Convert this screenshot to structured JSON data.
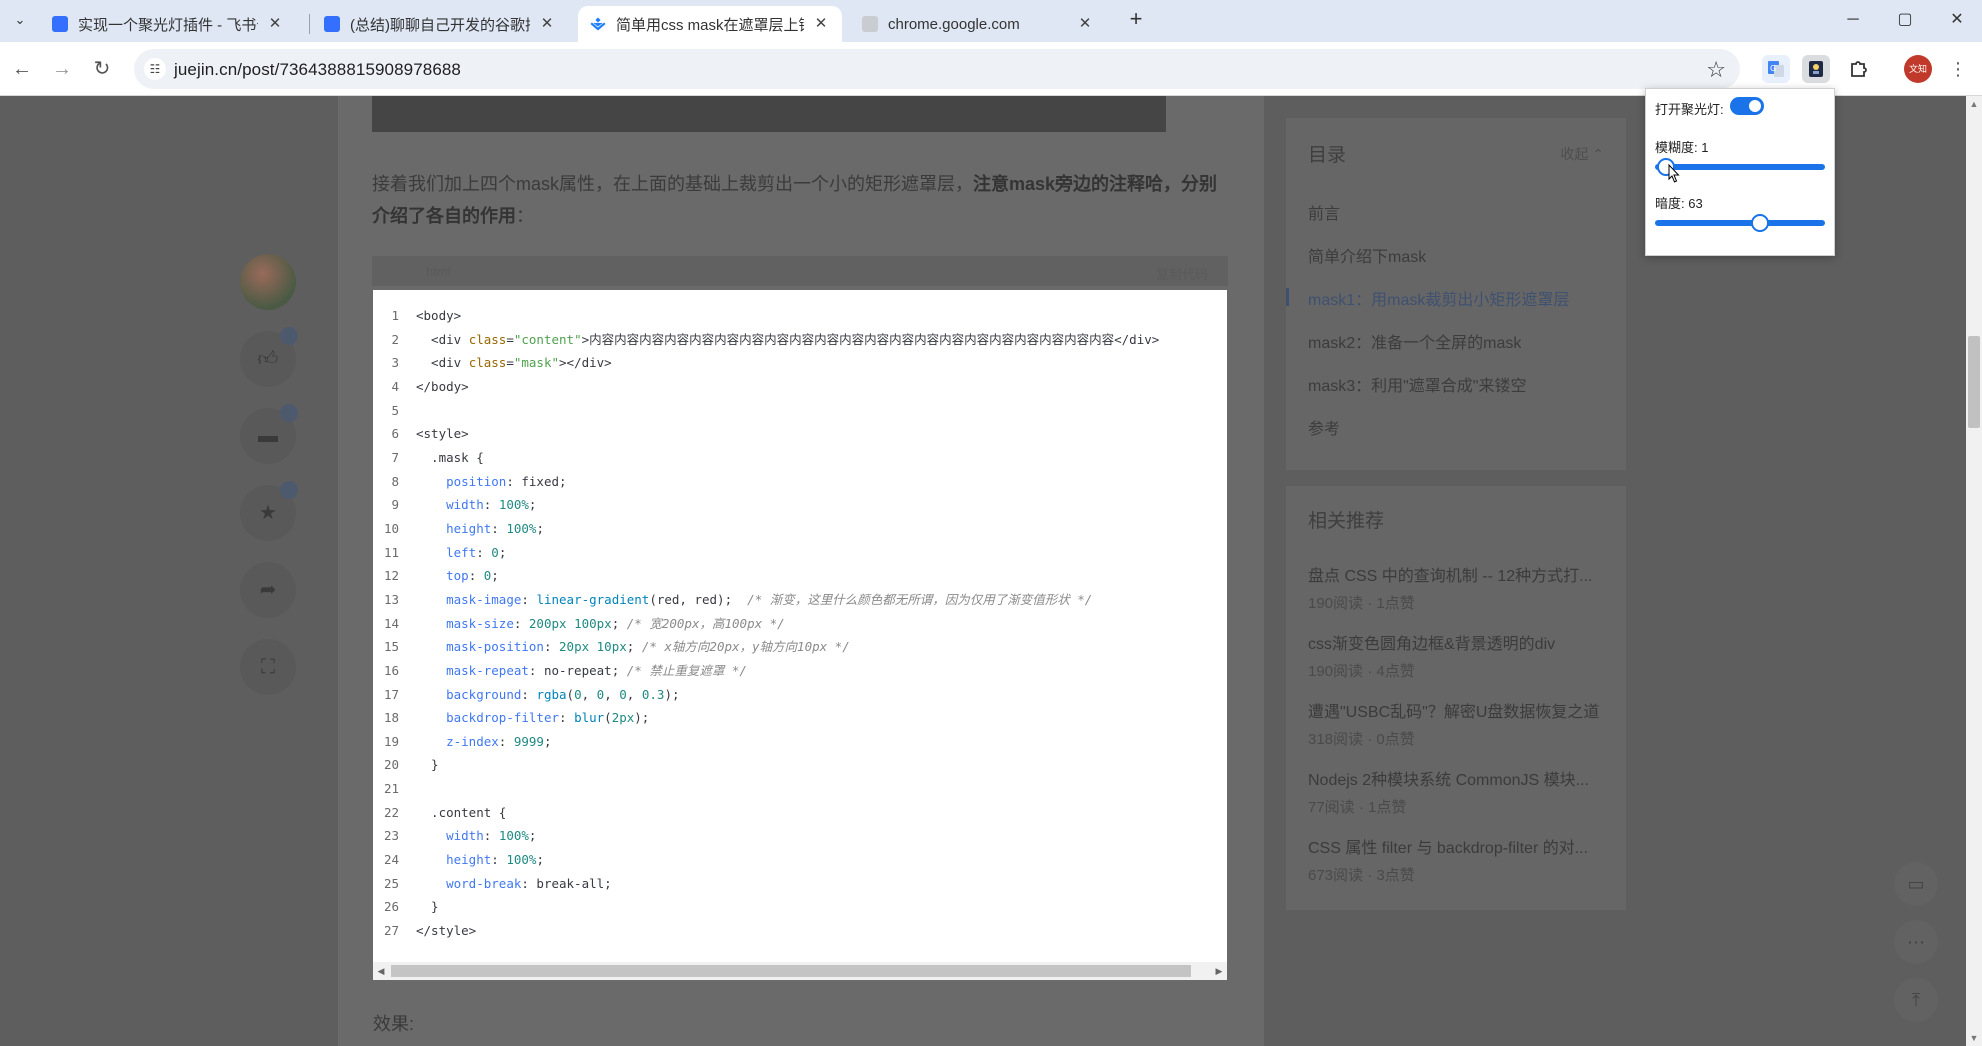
{
  "browser": {
    "tabs": [
      {
        "title": "实现一个聚光灯插件 - 飞书云文档",
        "favicon_color": "#3370ff",
        "active": false
      },
      {
        "title": "(总结)聊聊自己开发的谷歌插件 - 飞书云文档",
        "favicon_color": "#3370ff",
        "active": false
      },
      {
        "title": "简单用css mask在遮罩层上镂空",
        "favicon_color": "#1e80ff",
        "active": true
      },
      {
        "title": "chrome.google.com",
        "favicon_color": "#9aa0a6",
        "active": false
      }
    ],
    "url": "juejin.cn/post/7364388815908978688",
    "profile_label": "文知"
  },
  "article": {
    "paragraph_plain": "接着我们加上四个mask属性，在上面的基础上裁剪出一个小的矩形遮罩层，",
    "paragraph_bold": "注意mask旁边的注释哈，分别介绍了各自的作用",
    "paragraph_end": "：",
    "code_lang": "html",
    "code_copy": "复制代码",
    "effect_label": "效果:"
  },
  "code_lines": [
    "<body>",
    "  <div class=\"content\">内容内容内容内容内容内容内容内容内容内容内容内容内容内容内容内容内容内容内容内容内容</div>",
    "  <div class=\"mask\"></div>",
    "</body>",
    "",
    "<style>",
    "  .mask {",
    "    position: fixed;",
    "    width: 100%;",
    "    height: 100%;",
    "    left: 0;",
    "    top: 0;",
    "    mask-image: linear-gradient(red, red);  /* 渐变，这里什么颜色都无所谓，因为仅用了渐变值形状 */",
    "    mask-size: 200px 100px; /* 宽200px，高100px */",
    "    mask-position: 20px 10px; /* x轴方向20px，y轴方向10px */",
    "    mask-repeat: no-repeat; /* 禁止重复遮罩 */",
    "    background: rgba(0, 0, 0, 0.3);",
    "    backdrop-filter: blur(2px);",
    "    z-index: 9999;",
    "  }",
    "",
    "  .content {",
    "    width: 100%;",
    "    height: 100%;",
    "    word-break: break-all;",
    "  }",
    "</style>"
  ],
  "toc": {
    "title": "目录",
    "fold": "收起",
    "items": [
      {
        "label": "前言",
        "active": false
      },
      {
        "label": "简单介绍下mask",
        "active": false
      },
      {
        "label": "mask1：用mask裁剪出小矩形遮罩层",
        "active": true
      },
      {
        "label": "mask2：准备一个全屏的mask",
        "active": false
      },
      {
        "label": "mask3：利用\"遮罩合成\"来镂空",
        "active": false
      },
      {
        "label": "参考",
        "active": false
      }
    ]
  },
  "related": {
    "title": "相关推荐",
    "items": [
      {
        "title": "盘点 CSS 中的查询机制 -- 12种方式打...",
        "meta": "190阅读 · 1点赞"
      },
      {
        "title": "css渐变色圆角边框&背景透明的div",
        "meta": "190阅读 · 4点赞"
      },
      {
        "title": "遭遇\"USBC乱码\"？解密U盘数据恢复之道",
        "meta": "318阅读 · 0点赞"
      },
      {
        "title": "Nodejs 2种模块系统 CommonJS 模块...",
        "meta": "77阅读 · 1点赞"
      },
      {
        "title": "CSS 属性 filter 与 backdrop-filter 的对...",
        "meta": "673阅读 · 3点赞"
      }
    ]
  },
  "spotlight_popup": {
    "toggle_label": "打开聚光灯:",
    "toggle_on": true,
    "blur_label": "模糊度: 1",
    "blur_value": 1,
    "blur_max": 100,
    "dark_label": "暗度: 63",
    "dark_value": 63,
    "dark_max": 100
  },
  "colors": {
    "accent": "#1a73e8",
    "juejin_blue": "#1e80ff"
  }
}
